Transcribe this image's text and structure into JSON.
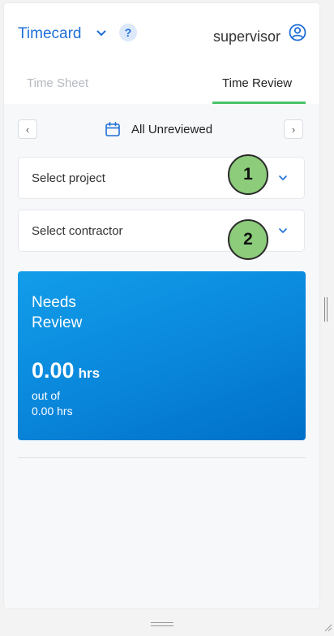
{
  "header": {
    "app_title": "Timecard",
    "help_label": "?",
    "user_name": "supervisor"
  },
  "tabs": [
    {
      "label": "Time Sheet",
      "active": false
    },
    {
      "label": "Time Review",
      "active": true
    }
  ],
  "nav": {
    "prev_label": "‹",
    "next_label": "›",
    "filter_label": "All Unreviewed"
  },
  "selects": {
    "project_placeholder": "Select project",
    "contractor_placeholder": "Select contractor"
  },
  "markers": [
    "1",
    "2"
  ],
  "summary_card": {
    "title": "Needs Review",
    "hours_value": "0.00",
    "hours_unit": "hrs",
    "out_of_label": "out of",
    "total_hours": "0.00 hrs"
  },
  "colors": {
    "accent_blue": "#1f6fd6",
    "active_tab_underline": "#4cc269",
    "card_gradient_start": "#129de9",
    "card_gradient_end": "#0070c8",
    "marker_fill": "#8ccc7a"
  },
  "icons": {
    "app_menu": "chevron-down-icon",
    "user": "user-circle-icon",
    "filter": "calendar-icon",
    "dropdown": "chevron-down-icon"
  }
}
